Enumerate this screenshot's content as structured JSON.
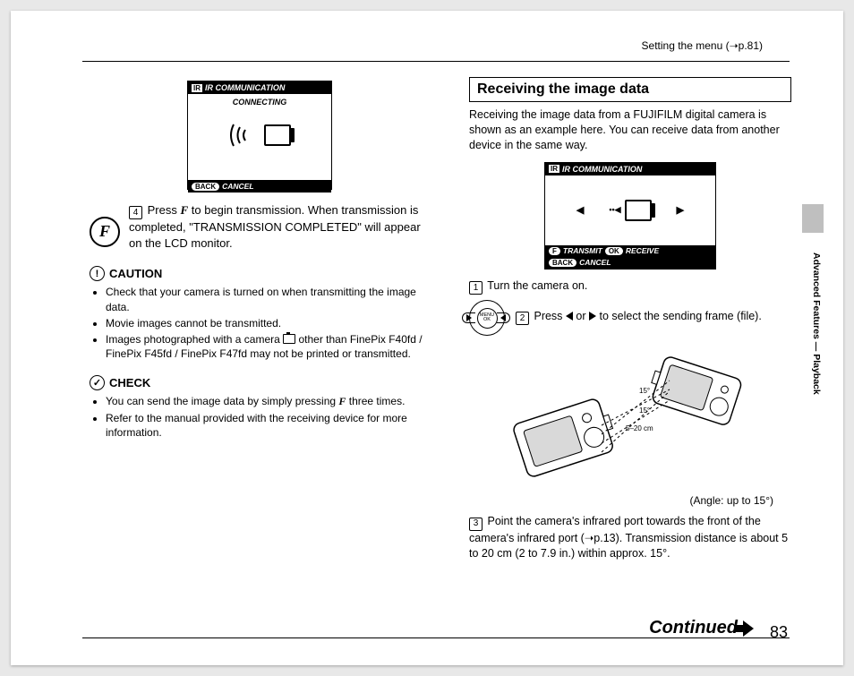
{
  "header": {
    "label": "Setting the menu (➝p.81)"
  },
  "side": {
    "tab_text": "Advanced Features — Playback"
  },
  "left": {
    "lcd": {
      "title_tag": "IR",
      "title": "IR COMMUNICATION",
      "status": "CONNECTING",
      "cancel_pill": "BACK",
      "cancel_label": "CANCEL"
    },
    "step4": {
      "num": "4",
      "text_before": "Press ",
      "f_glyph": "F",
      "text_after": " to begin transmission. When transmission is completed, \"TRANSMISSION COMPLETED\" will appear on the LCD monitor.",
      "big_f": "F"
    },
    "caution": {
      "title": "CAUTION",
      "items": [
        "Check that your camera is turned on when transmitting the image data.",
        "Movie images cannot be transmitted.",
        "Images photographed with a camera  other than FinePix F40fd / FinePix F45fd / FinePix F47fd may not be printed or transmitted."
      ]
    },
    "check": {
      "title": "CHECK",
      "item1_before": "You can send the image data by simply pressing ",
      "item1_f": "F",
      "item1_after": " three times.",
      "item2": "Refer to the manual provided with the receiving device for more information."
    }
  },
  "right": {
    "section_title": "Receiving the image data",
    "intro": "Receiving the image data from a FUJIFILM digital camera is shown as an example here. You can receive data from another device in the same way.",
    "lcd": {
      "title_tag": "IR",
      "title": "IR COMMUNICATION",
      "transmit_pill": "F",
      "transmit_label": "TRANSMIT",
      "receive_pill": "OK",
      "receive_label": "RECEIVE",
      "cancel_pill": "BACK",
      "cancel_label": "CANCEL"
    },
    "step1": {
      "num": "1",
      "text": "Turn the camera on."
    },
    "step2": {
      "num": "2",
      "text_before": "Press ",
      "text_mid": " or ",
      "text_after": " to select the sending frame (file).",
      "dial_center_top": "MENU",
      "dial_center_bottom": "OK"
    },
    "diagram": {
      "angle_top": "15°",
      "angle_bottom": "15°",
      "distance": "5–20 cm",
      "angle_note": "(Angle: up to 15°)"
    },
    "step3": {
      "num": "3",
      "text": "Point the camera's infrared port towards the front of the camera's infrared port (➝p.13). Transmission distance is about 5 to 20 cm (2 to 7.9 in.) within approx. 15°."
    }
  },
  "footer": {
    "continued": "Continued",
    "page": "83"
  }
}
